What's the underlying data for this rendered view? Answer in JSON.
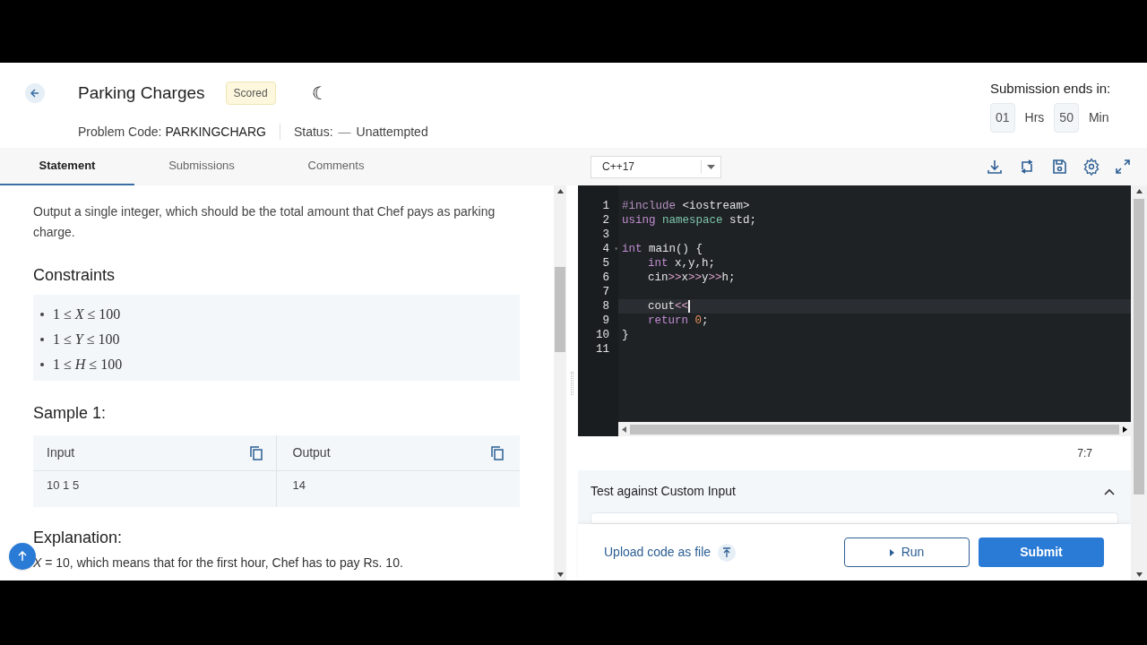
{
  "header": {
    "title": "Parking Charges",
    "badge": "Scored",
    "theme_glyph": "☾",
    "problem_code_label": "Problem Code:",
    "problem_code": "PARKINGCHARG",
    "status_label": "Status:",
    "status_dash": "—",
    "status": "Unattempted"
  },
  "timer": {
    "label": "Submission ends in:",
    "hours": "01",
    "hours_unit": "Hrs",
    "minutes": "50",
    "minutes_unit": "Min"
  },
  "tabs": [
    {
      "label": "Statement",
      "selected": true
    },
    {
      "label": "Submissions",
      "selected": false
    },
    {
      "label": "Comments",
      "selected": false
    }
  ],
  "statement": {
    "output_text": "Output a single integer, which should be the total amount that Chef pays as parking charge.",
    "constraints_title": "Constraints",
    "constraints": [
      "1 ≤ *X* ≤ 100",
      "1 ≤ *Y* ≤ 100",
      "1 ≤ *H* ≤ 100"
    ],
    "sample_title": "Sample 1:",
    "sample": {
      "input_label": "Input",
      "output_label": "Output",
      "input": "10 1 5",
      "output": "14"
    },
    "explanation_title": "Explanation:",
    "explanation": "*X* = 10, which means that for the first hour, Chef has to pay Rs. 10."
  },
  "editor": {
    "language": "C++17",
    "lines": [
      {
        "number": "1",
        "indented": false,
        "active": false,
        "tokens": [
          {
            "kind": "directive",
            "text": "#include"
          },
          {
            "kind": "plain",
            "text": " <iostream>"
          }
        ]
      },
      {
        "number": "2",
        "indented": false,
        "active": false,
        "tokens": [
          {
            "kind": "keyword",
            "text": "using"
          },
          {
            "kind": "type",
            "text": " namespace"
          },
          {
            "kind": "plain",
            "text": " std;"
          }
        ]
      },
      {
        "number": "3",
        "active": false
      },
      {
        "number": "4",
        "indented": false,
        "active": false,
        "fold": "▾",
        "tokens": [
          {
            "kind": "keyword",
            "text": "int"
          },
          {
            "kind": "plain",
            "text": " main() {"
          }
        ]
      },
      {
        "number": "5",
        "indented": true,
        "active": false,
        "tokens": [
          {
            "kind": "keyword",
            "text": "int"
          },
          {
            "kind": "plain",
            "text": " x,y,h;"
          }
        ]
      },
      {
        "number": "6",
        "indented": true,
        "active": false,
        "tokens": [
          {
            "kind": "plain",
            "text": "cin"
          },
          {
            "kind": "operator",
            "text": ">>"
          },
          {
            "kind": "plain",
            "text": "x"
          },
          {
            "kind": "operator",
            "text": ">>"
          },
          {
            "kind": "plain",
            "text": "y"
          },
          {
            "kind": "operator",
            "text": ">>"
          },
          {
            "kind": "plain",
            "text": "h;"
          }
        ]
      },
      {
        "number": "7",
        "active": false
      },
      {
        "number": "8",
        "indented": true,
        "active": true,
        "tokens": [
          {
            "kind": "plain",
            "text": "cout"
          },
          {
            "kind": "operator",
            "text": "<<"
          }
        ]
      },
      {
        "number": "9",
        "indented": true,
        "active": false,
        "tokens": [
          {
            "kind": "keyword",
            "text": "return"
          },
          {
            "kind": "number",
            "text": " 0"
          },
          {
            "kind": "plain",
            "text": ";"
          }
        ]
      },
      {
        "number": "10",
        "indented": false,
        "active": false,
        "tokens": [
          {
            "kind": "plain",
            "text": "}"
          }
        ]
      },
      {
        "number": "11",
        "active": false
      }
    ],
    "cursor_position": "7:7"
  },
  "custom_input": {
    "title": "Test against Custom Input",
    "expanded": true
  },
  "actions": {
    "upload": "Upload code as file",
    "run": "Run",
    "submit": "Submit"
  }
}
